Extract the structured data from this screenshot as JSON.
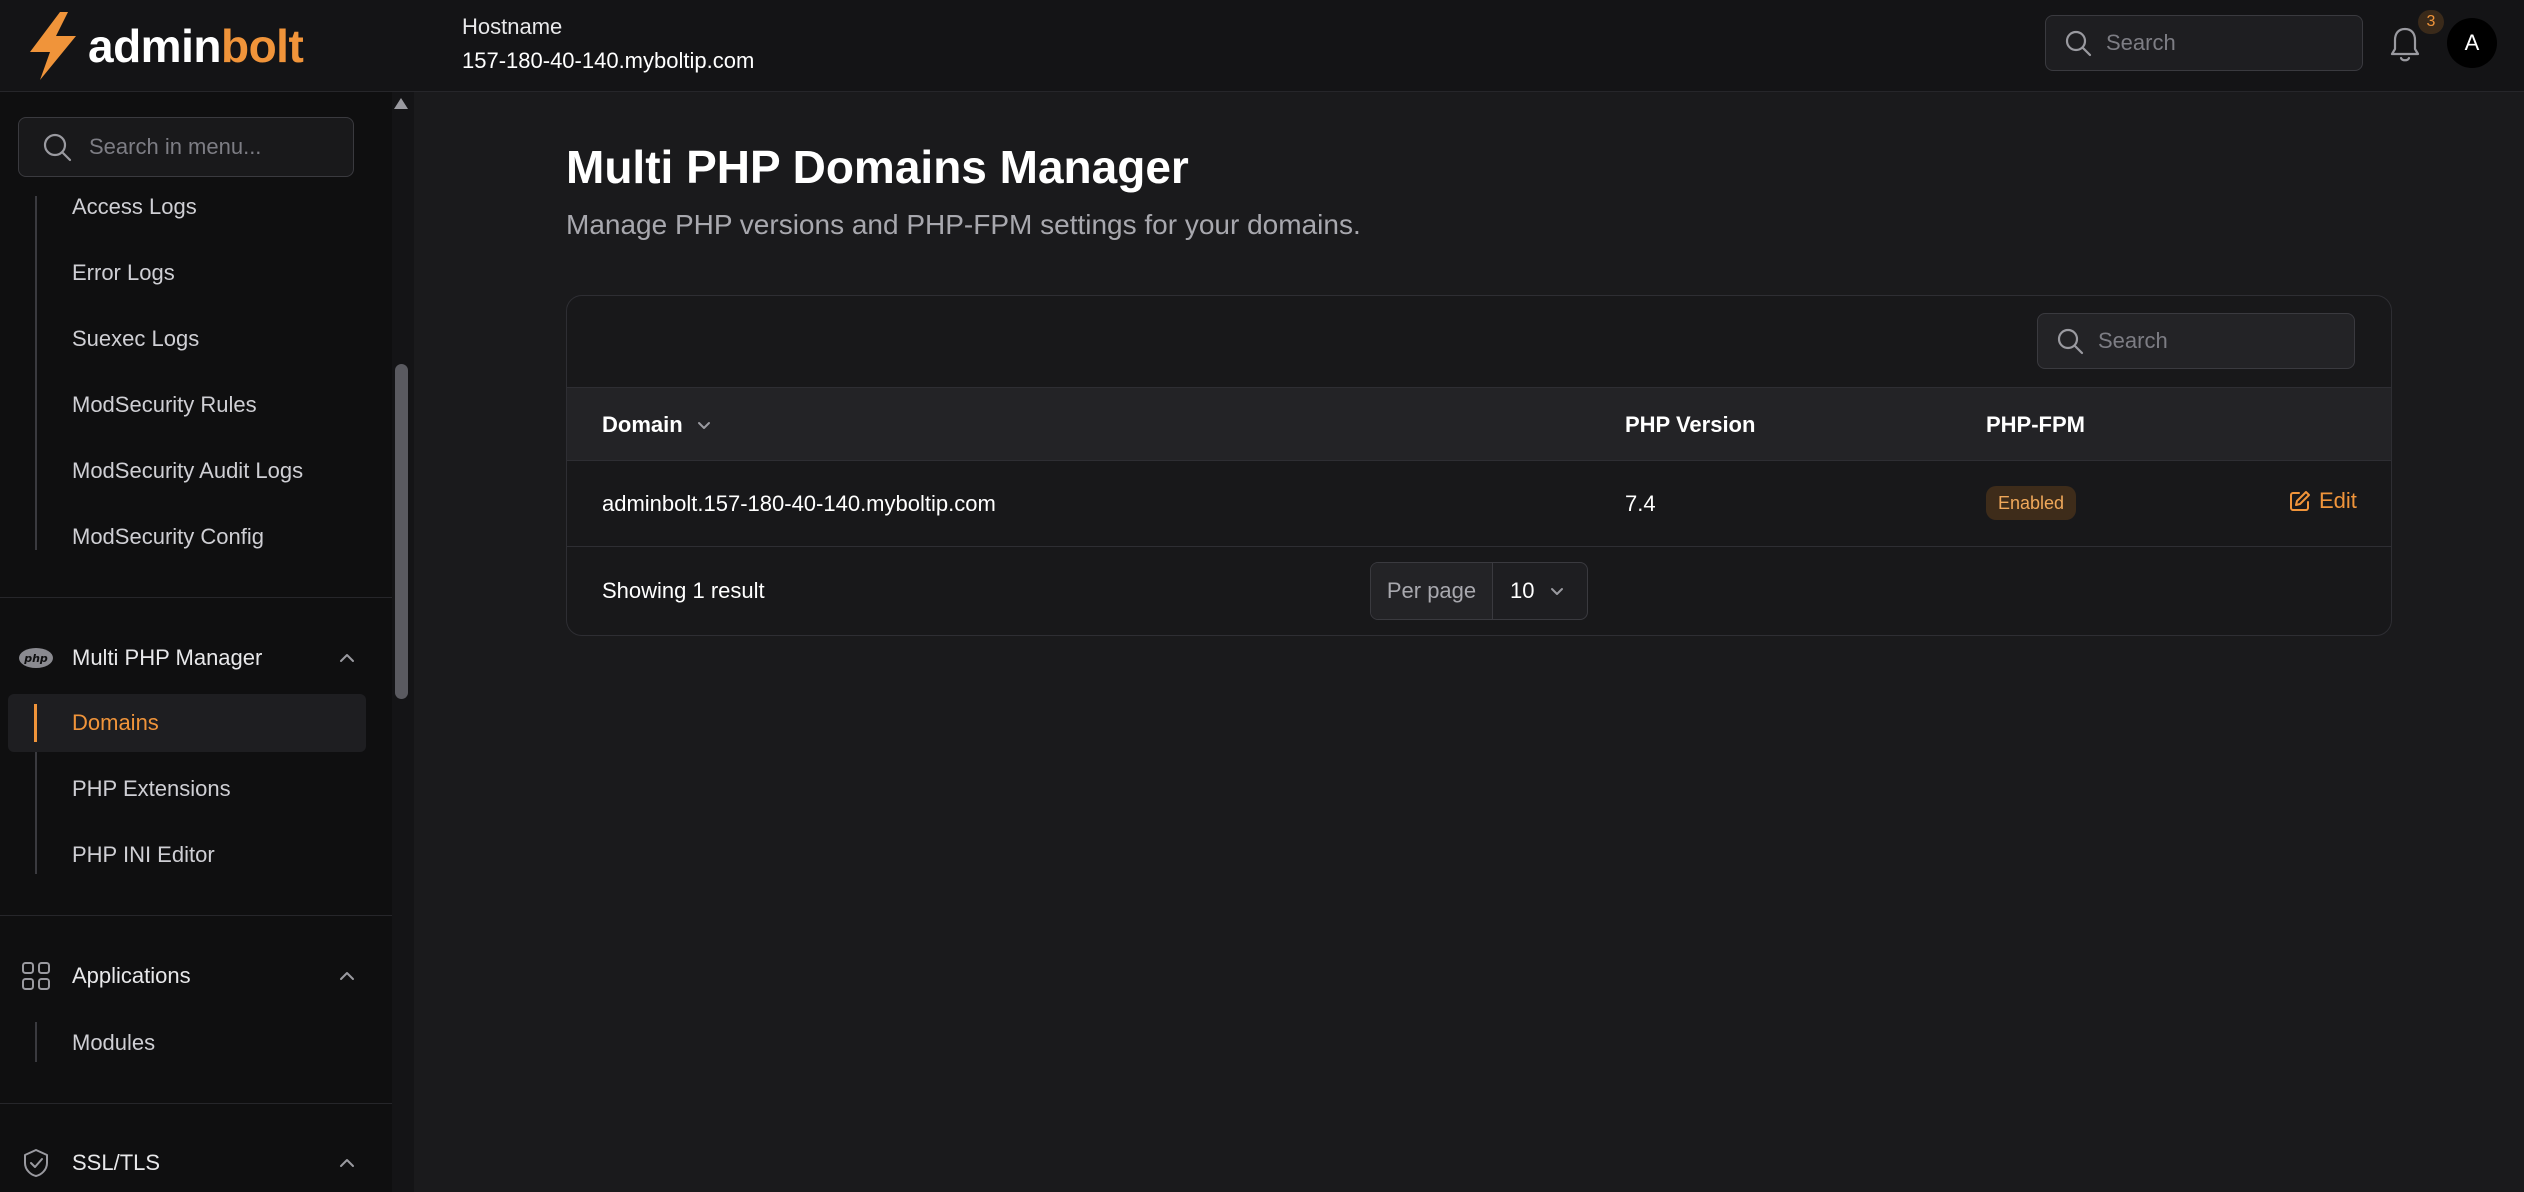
{
  "brand": {
    "part1": "admin",
    "part2": "bolt",
    "accent": "#f0943a"
  },
  "header": {
    "hostname_label": "Hostname",
    "hostname_value": "157-180-40-140.myboltip.com",
    "search_placeholder": "Search",
    "notification_count": "3",
    "avatar_initial": "A"
  },
  "sidebar": {
    "search_placeholder": "Search in menu...",
    "log_items": [
      "Access Logs",
      "Error Logs",
      "Suexec Logs",
      "ModSecurity Rules",
      "ModSecurity Audit Logs",
      "ModSecurity Config"
    ],
    "groups": [
      {
        "label": "Multi PHP Manager",
        "icon": "php-icon",
        "items": [
          "Domains",
          "PHP Extensions",
          "PHP INI Editor"
        ],
        "active": "Domains"
      },
      {
        "label": "Applications",
        "icon": "grid-icon",
        "items": [
          "Modules"
        ]
      },
      {
        "label": "SSL/TLS",
        "icon": "shield-check-icon",
        "items": []
      }
    ]
  },
  "main": {
    "title": "Multi PHP Domains Manager",
    "subtitle": "Manage PHP versions and PHP-FPM settings for your domains.",
    "table_search_placeholder": "Search",
    "columns": [
      "Domain",
      "PHP Version",
      "PHP-FPM"
    ],
    "rows": [
      {
        "domain": "adminbolt.157-180-40-140.myboltip.com",
        "php_version": "7.4",
        "php_fpm": "Enabled",
        "action": "Edit"
      }
    ],
    "footer": {
      "result_text": "Showing 1 result",
      "per_page_label": "Per page",
      "per_page_value": "10"
    }
  }
}
